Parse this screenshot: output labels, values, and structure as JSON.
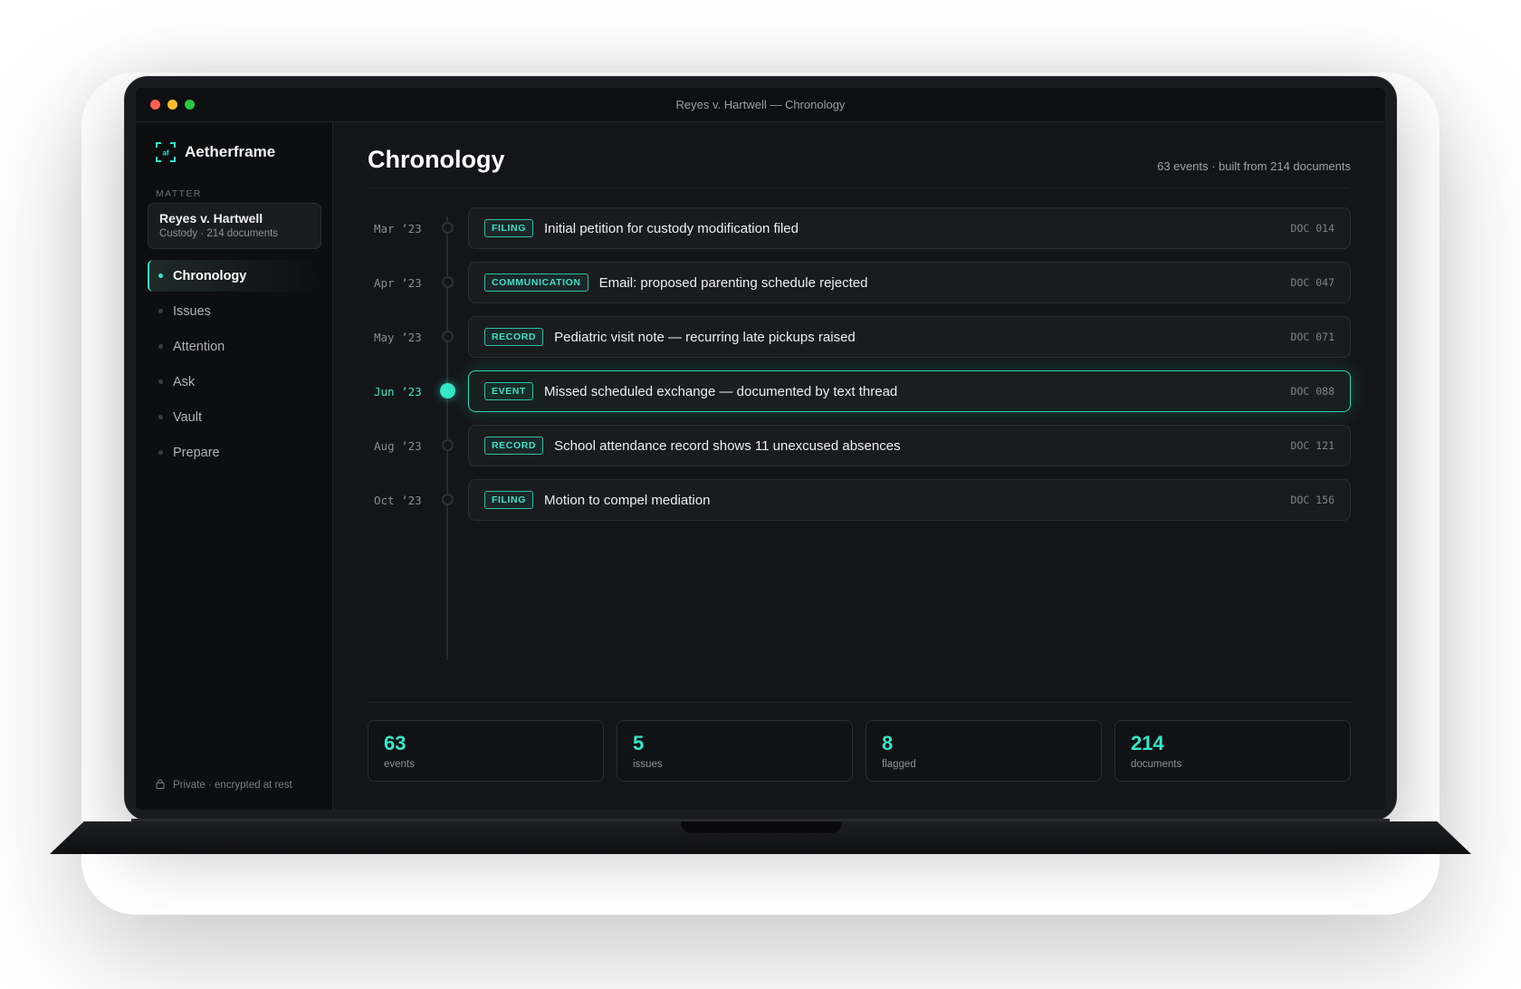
{
  "window": {
    "title": "Reyes v. Hartwell — Chronology"
  },
  "sidebar": {
    "brand": "Aetherframe",
    "section_label": "MATTER",
    "matter": {
      "name": "Reyes v. Hartwell",
      "meta": "Custody · 214 documents"
    },
    "items": [
      {
        "label": "Chronology",
        "active": true
      },
      {
        "label": "Issues"
      },
      {
        "label": "Attention"
      },
      {
        "label": "Ask"
      },
      {
        "label": "Vault"
      },
      {
        "label": "Prepare"
      }
    ],
    "footer": "Private · encrypted at rest"
  },
  "main": {
    "title": "Chronology",
    "summary": "63 events · built from 214 documents",
    "events": [
      {
        "date": "Mar ’23",
        "tag": "FILING",
        "text": "Initial petition for custody modification filed",
        "doc": "DOC 014"
      },
      {
        "date": "Apr ’23",
        "tag": "COMMUNICATION",
        "text": "Email: proposed parenting schedule rejected",
        "doc": "DOC 047"
      },
      {
        "date": "May ’23",
        "tag": "RECORD",
        "text": "Pediatric visit note — recurring late pickups raised",
        "doc": "DOC 071"
      },
      {
        "date": "Jun ’23",
        "tag": "EVENT",
        "text": "Missed scheduled exchange — documented by text thread",
        "doc": "DOC 088",
        "active": true
      },
      {
        "date": "Aug ’23",
        "tag": "RECORD",
        "text": "School attendance record shows 11 unexcused absences",
        "doc": "DOC 121"
      },
      {
        "date": "Oct ’23",
        "tag": "FILING",
        "text": "Motion to compel mediation",
        "doc": "DOC 156"
      }
    ],
    "stats": [
      {
        "value": "63",
        "label": "events"
      },
      {
        "value": "5",
        "label": "issues"
      },
      {
        "value": "8",
        "label": "flagged"
      },
      {
        "value": "214",
        "label": "documents"
      }
    ]
  },
  "colors": {
    "accent": "#2ee6c8",
    "background": "#141518",
    "sidebar": "#0d0e10",
    "card": "#1a1b1f"
  },
  "icons": {
    "brand": "frame-logo-icon",
    "footer": "lock-icon"
  }
}
